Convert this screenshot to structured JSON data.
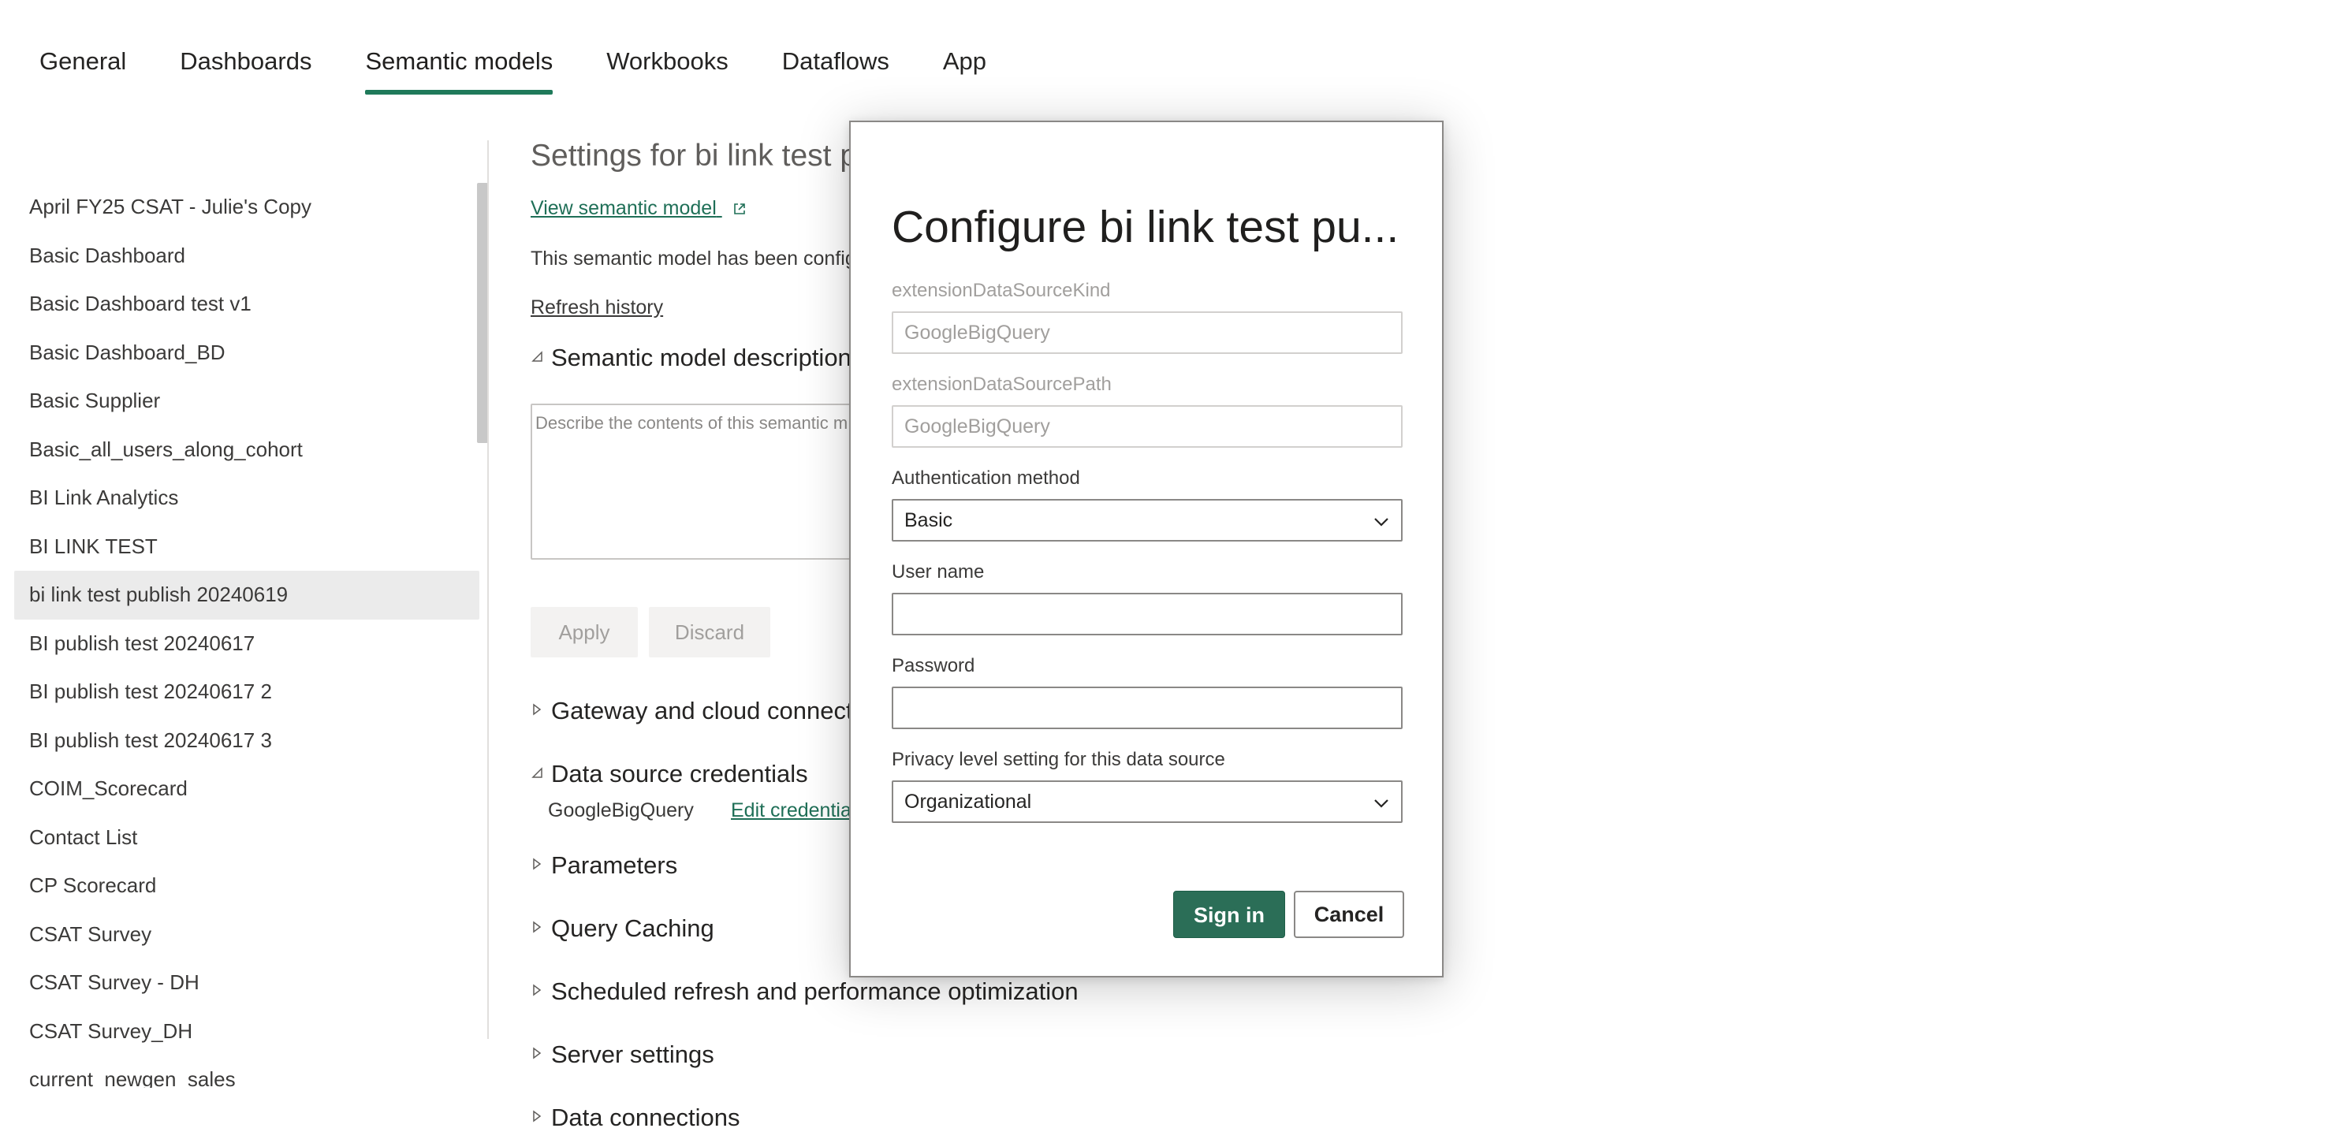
{
  "tabs": [
    "General",
    "Dashboards",
    "Semantic models",
    "Workbooks",
    "Dataflows",
    "App"
  ],
  "active_tab": "Semantic models",
  "sidebar": {
    "items": [
      {
        "label": "April FY25 CSAT - Julie's Copy"
      },
      {
        "label": "Basic Dashboard"
      },
      {
        "label": "Basic Dashboard test v1"
      },
      {
        "label": "Basic Dashboard_BD"
      },
      {
        "label": "Basic Supplier"
      },
      {
        "label": "Basic_all_users_along_cohort"
      },
      {
        "label": "BI Link Analytics"
      },
      {
        "label": "BI LINK TEST"
      },
      {
        "label": "bi link test publish 20240619"
      },
      {
        "label": "BI publish test 20240617"
      },
      {
        "label": "BI publish test 20240617 2"
      },
      {
        "label": "BI publish test 20240617 3"
      },
      {
        "label": "COIM_Scorecard"
      },
      {
        "label": "Contact List"
      },
      {
        "label": "CP Scorecard"
      },
      {
        "label": "CSAT Survey"
      },
      {
        "label": "CSAT Survey - DH"
      },
      {
        "label": "CSAT Survey_DH"
      },
      {
        "label": "current_newgen_sales"
      }
    ],
    "selected": "bi link test publish 20240619"
  },
  "main": {
    "settings_title": "Settings for bi link test pu",
    "view_link": "View semantic model",
    "description_text": "This semantic model has been configu",
    "refresh_history": "Refresh history",
    "sections": {
      "description": "Semantic model description",
      "gateway": "Gateway and cloud connect",
      "credentials": "Data source credentials",
      "parameters": "Parameters",
      "query_caching": "Query Caching",
      "scheduled_refresh": "Scheduled refresh and performance optimization",
      "server_settings": "Server settings",
      "data_connections": "Data connections"
    },
    "description_placeholder": "Describe the contents of this semantic m",
    "apply_label": "Apply",
    "discard_label": "Discard",
    "credential_source": "GoogleBigQuery",
    "edit_credentials": "Edit credentials"
  },
  "dialog": {
    "title": "Configure bi link test pu...",
    "kind_label": "extensionDataSourceKind",
    "kind_value": "GoogleBigQuery",
    "path_label": "extensionDataSourcePath",
    "path_value": "GoogleBigQuery",
    "auth_label": "Authentication method",
    "auth_value": "Basic",
    "username_label": "User name",
    "username_value": "",
    "password_label": "Password",
    "password_value": "",
    "privacy_label": "Privacy level setting for this data source",
    "privacy_value": "Organizational",
    "sign_in": "Sign in",
    "cancel": "Cancel"
  },
  "colors": {
    "accent": "#1f7a5a",
    "primary_button": "#2b6e57",
    "link": "#1f6f57",
    "selected_bg": "#ebebeb"
  }
}
